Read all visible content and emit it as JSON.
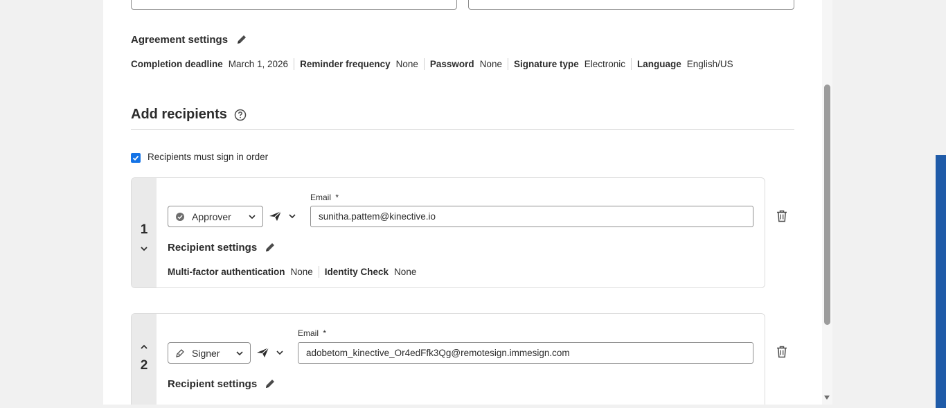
{
  "agreement": {
    "title": "Agreement settings",
    "settings": [
      {
        "label": "Completion deadline",
        "value": "March 1, 2026"
      },
      {
        "label": "Reminder frequency",
        "value": "None"
      },
      {
        "label": "Password",
        "value": "None"
      },
      {
        "label": "Signature type",
        "value": "Electronic"
      },
      {
        "label": "Language",
        "value": "English/US"
      }
    ]
  },
  "recipients": {
    "title": "Add recipients",
    "sign_in_order_label": "Recipients must sign in order",
    "sign_in_order_checked": true,
    "list": [
      {
        "number": "1",
        "role": "Approver",
        "email_label": "Email",
        "required_mark": "*",
        "email": "sunitha.pattem@kinective.io",
        "settings_title": "Recipient settings",
        "settings": [
          {
            "label": "Multi-factor authentication",
            "value": "None"
          },
          {
            "label": "Identity Check",
            "value": "None"
          }
        ]
      },
      {
        "number": "2",
        "role": "Signer",
        "email_label": "Email",
        "required_mark": "*",
        "email": "adobetom_kinective_Or4edFfk3Qg@remotesign.immesign.com",
        "settings_title": "Recipient settings"
      }
    ]
  },
  "colors": {
    "accent": "#1473e6",
    "side_bar": "#1f5ba8"
  }
}
